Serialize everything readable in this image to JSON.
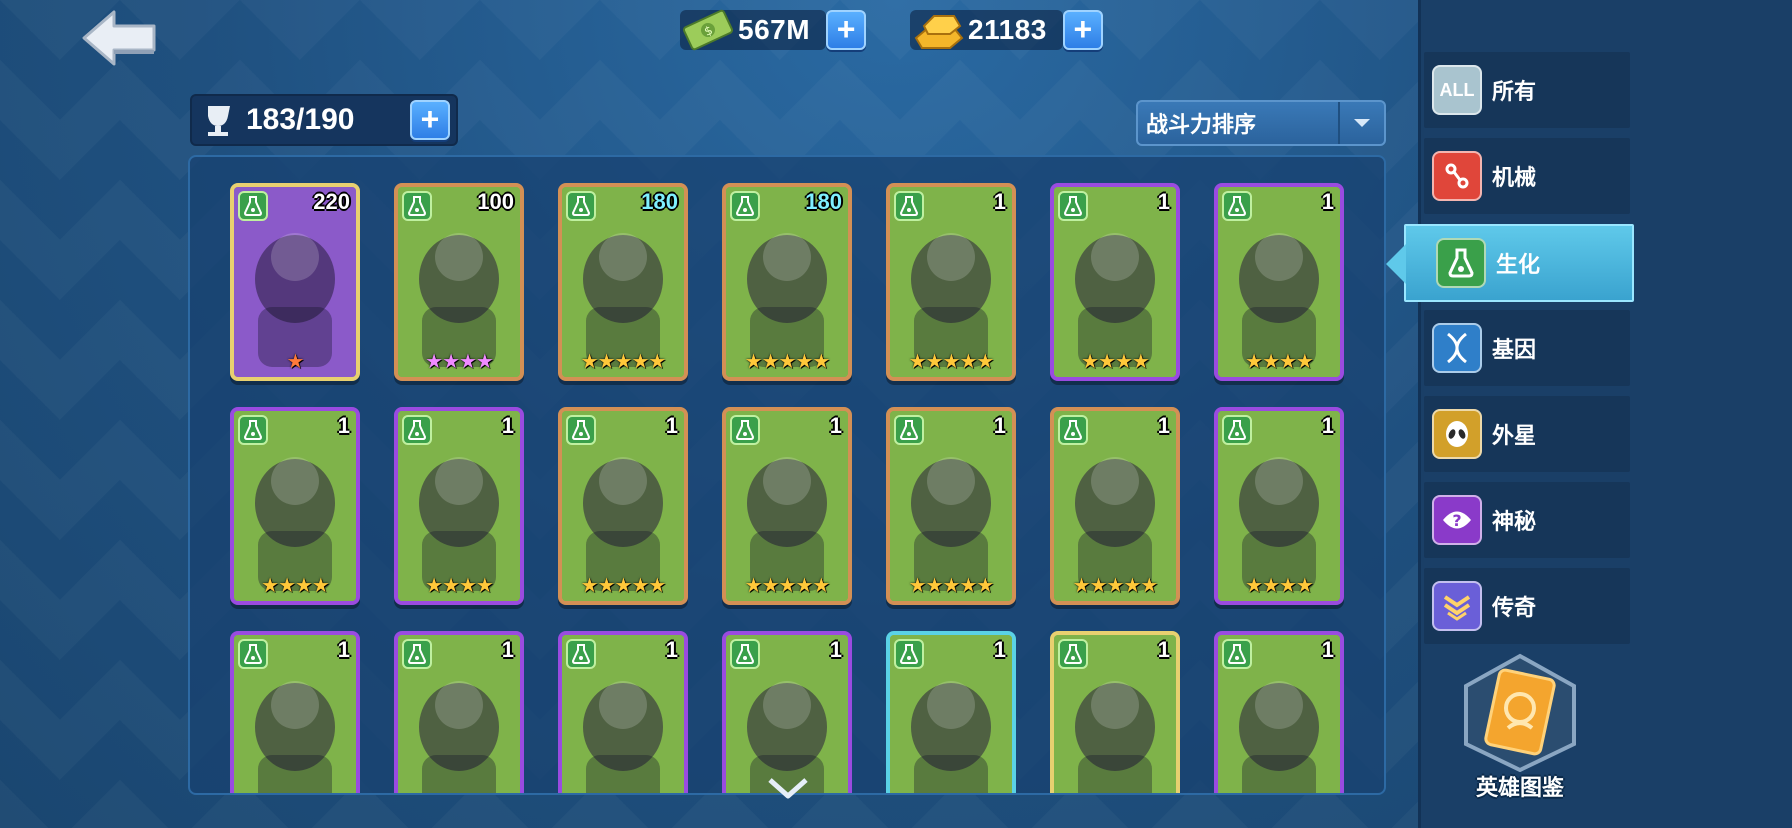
{
  "currencies": [
    {
      "name": "cash",
      "icon": "cash-icon",
      "value": "567M"
    },
    {
      "name": "gold",
      "icon": "gold-bar-icon",
      "value": "21183"
    }
  ],
  "roster": {
    "count": "183/190"
  },
  "sort": {
    "label": "战斗力排序"
  },
  "sidebar": {
    "items": [
      {
        "label": "所有",
        "icon": "all-icon",
        "icon_text": "ALL",
        "color": "#a9c4cf"
      },
      {
        "label": "机械",
        "icon": "mechanical-icon",
        "color": "#e0463a"
      },
      {
        "label": "生化",
        "icon": "biochem-flask-icon",
        "color": "#3aa04a",
        "active": true
      },
      {
        "label": "基因",
        "icon": "dna-icon",
        "color": "#2f7fc9"
      },
      {
        "label": "外星",
        "icon": "alien-icon",
        "color": "#d2a02a"
      },
      {
        "label": "神秘",
        "icon": "mystery-icon",
        "color": "#8a3ac9"
      },
      {
        "label": "传奇",
        "icon": "legend-icon",
        "color": "#6a5fd8"
      }
    ],
    "codex_label": "英雄图鉴"
  },
  "heroes": [
    {
      "level": "220",
      "stars": "★",
      "star_color": "orange",
      "frame": "gold",
      "art": "#8b5ac9",
      "level_color": "white"
    },
    {
      "level": "100",
      "stars": "★★★★",
      "star_color": "pink",
      "frame": "orange",
      "art": "#7fb34a",
      "level_color": "white"
    },
    {
      "level": "180",
      "stars": "★★★★★",
      "star_color": "gold",
      "frame": "orange",
      "art": "#7fb34a",
      "level_color": "cyan"
    },
    {
      "level": "180",
      "stars": "★★★★★",
      "star_color": "gold",
      "frame": "orange",
      "art": "#7fb34a",
      "level_color": "cyan"
    },
    {
      "level": "1",
      "stars": "★★★★★",
      "star_color": "gold",
      "frame": "orange",
      "art": "#7fb34a",
      "level_color": "white"
    },
    {
      "level": "1",
      "stars": "★★★★",
      "star_color": "gold",
      "frame": "purple",
      "art": "#7fb34a",
      "level_color": "white"
    },
    {
      "level": "1",
      "stars": "★★★★",
      "star_color": "gold",
      "frame": "purple",
      "art": "#7fb34a",
      "level_color": "white"
    },
    {
      "level": "1",
      "stars": "★★★★",
      "star_color": "gold",
      "frame": "purple",
      "art": "#7fb34a",
      "level_color": "white"
    },
    {
      "level": "1",
      "stars": "★★★★",
      "star_color": "gold",
      "frame": "purple",
      "art": "#7fb34a",
      "level_color": "white"
    },
    {
      "level": "1",
      "stars": "★★★★★",
      "star_color": "gold",
      "frame": "orange",
      "art": "#7fb34a",
      "level_color": "white"
    },
    {
      "level": "1",
      "stars": "★★★★★",
      "star_color": "gold",
      "frame": "orange",
      "art": "#7fb34a",
      "level_color": "white"
    },
    {
      "level": "1",
      "stars": "★★★★★",
      "star_color": "gold",
      "frame": "orange",
      "art": "#7fb34a",
      "level_color": "white"
    },
    {
      "level": "1",
      "stars": "★★★★★",
      "star_color": "gold",
      "frame": "orange",
      "art": "#7fb34a",
      "level_color": "white"
    },
    {
      "level": "1",
      "stars": "★★★★",
      "star_color": "gold",
      "frame": "purple",
      "art": "#7fb34a",
      "level_color": "white"
    },
    {
      "level": "1",
      "stars": "",
      "star_color": "gold",
      "frame": "purple",
      "art": "#7fb34a",
      "level_color": "white"
    },
    {
      "level": "1",
      "stars": "",
      "star_color": "gold",
      "frame": "purple",
      "art": "#7fb34a",
      "level_color": "white"
    },
    {
      "level": "1",
      "stars": "",
      "star_color": "gold",
      "frame": "purple",
      "art": "#7fb34a",
      "level_color": "white"
    },
    {
      "level": "1",
      "stars": "",
      "star_color": "gold",
      "frame": "purple",
      "art": "#7fb34a",
      "level_color": "white"
    },
    {
      "level": "1",
      "stars": "",
      "star_color": "gold",
      "frame": "cyan",
      "art": "#7fb34a",
      "level_color": "white"
    },
    {
      "level": "1",
      "stars": "",
      "star_color": "gold",
      "frame": "gold",
      "art": "#7fb34a",
      "level_color": "white"
    },
    {
      "level": "1",
      "stars": "",
      "star_color": "gold",
      "frame": "purple",
      "art": "#7fb34a",
      "level_color": "white"
    }
  ]
}
